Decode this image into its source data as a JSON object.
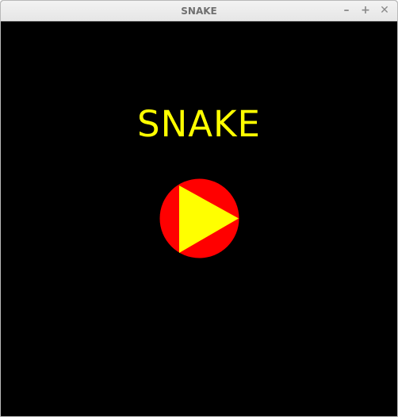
{
  "window": {
    "title": "SNAKE",
    "minimize_glyph": "–",
    "maximize_glyph": "+",
    "close_glyph": "✕"
  },
  "game": {
    "title": "SNAKE",
    "play_icon": "play-triangle-in-circle",
    "colors": {
      "background": "#000000",
      "title": "#ffff00",
      "play_circle": "#ff0000",
      "play_triangle": "#ffff00"
    }
  }
}
